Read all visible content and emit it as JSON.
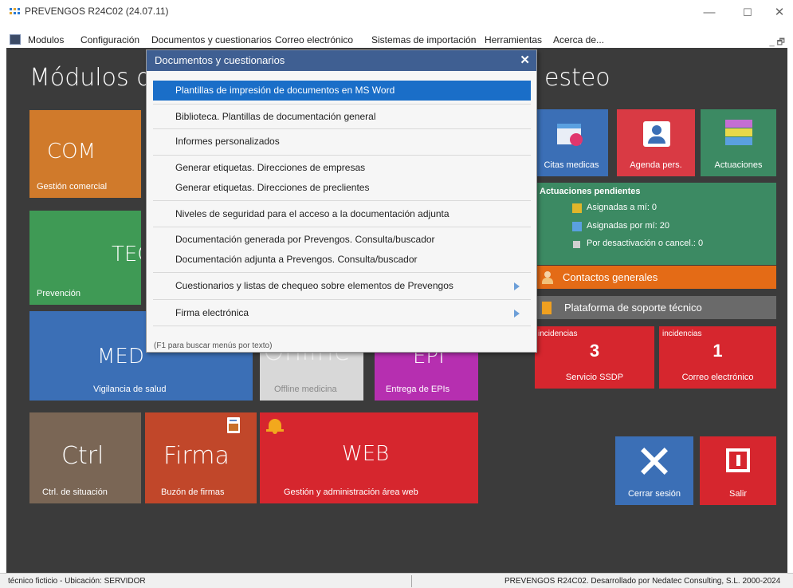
{
  "window": {
    "title": "PREVENGOS R24C02 (24.07.11)",
    "controls": {
      "minimize": "—",
      "maximize": "☐",
      "close": "✕"
    }
  },
  "menubar": {
    "items": [
      "Modulos",
      "Configuración",
      "Documentos y cuestionarios",
      "Correo electrónico",
      "Sistemas de importación",
      "Herramientas",
      "Acerca de..."
    ],
    "right_controls": "_ 🗗"
  },
  "main": {
    "heading_left": "Módulos d",
    "heading_right": "esteo",
    "tiles": {
      "com": {
        "big": "COM",
        "caption": "Gestión comercial",
        "color": "#d07a2b"
      },
      "tec": {
        "big": "TEC",
        "caption": "Prevención",
        "color": "#3f9a55"
      },
      "med": {
        "big": "MED",
        "caption": "Vigilancia de salud",
        "color": "#3b6fb6"
      },
      "offline": {
        "big": "Online",
        "caption": "Offline medicina",
        "color": "#d8d8d8"
      },
      "epi": {
        "big": "EPI",
        "caption": "Entrega de EPIs",
        "color": "#b62fb0"
      },
      "ctrl": {
        "big": "Ctrl",
        "caption": "Ctrl. de situación",
        "color": "#7a6655"
      },
      "firma": {
        "big": "Firma",
        "caption": "Buzón de firmas",
        "color": "#c1472a"
      },
      "web": {
        "big": "WEB",
        "caption": "Gestión y administración área web",
        "color": "#d6262e"
      },
      "citas": {
        "caption": "Citas medicas",
        "color": "#3b6fb6"
      },
      "agenda": {
        "caption": "Agenda pers.",
        "color": "#d93a44"
      },
      "actuaciones": {
        "caption": "Actuaciones",
        "color": "#3c8a63"
      },
      "cerrar": {
        "caption": "Cerrar sesión",
        "color": "#3b6fb6"
      },
      "salir": {
        "caption": "Salir",
        "color": "#d6262e"
      }
    },
    "pending": {
      "title": "Actuaciones pendientes",
      "assigned_to_me": "Asignadas a mí: 0",
      "assigned_by_me": "Asignadas por mí: 20",
      "deactivated": "Por desactivación o cancel.: 0",
      "color": "#3c8a63"
    },
    "contacts": {
      "label": "Contactos generales",
      "color": "#e46b16"
    },
    "support": {
      "label": "Plataforma de soporte técnico",
      "color": "#6a6a6a"
    },
    "incidents": [
      {
        "header": "incidencias",
        "count": "3",
        "label": "Servicio SSDP",
        "color": "#d6262e"
      },
      {
        "header": "incidencias",
        "count": "1",
        "label": "Correo electrónico",
        "color": "#d6262e"
      }
    ]
  },
  "dropdown": {
    "title": "Documentos y cuestionarios",
    "close": "✕",
    "items": [
      "Plantillas de impresión de documentos en MS Word",
      "Biblioteca. Plantillas de documentación general",
      "Informes personalizados",
      "Generar etiquetas. Direcciones de empresas",
      "Generar etiquetas. Direcciones de preclientes",
      "Niveles de seguridad para el acceso a la documentación adjunta",
      "Documentación generada por Prevengos. Consulta/buscador",
      "Documentación adjunta a Prevengos. Consulta/buscador",
      "Cuestionarios y listas de chequeo sobre elementos de Prevengos",
      "Firma electrónica"
    ],
    "hint": "(F1 para buscar menús por texto)"
  },
  "status": {
    "left": "técnico ficticio  -  Ubicación: SERVIDOR",
    "right": "PREVENGOS R24C02. Desarrollado por Nedatec Consulting, S.L. 2000-2024"
  }
}
